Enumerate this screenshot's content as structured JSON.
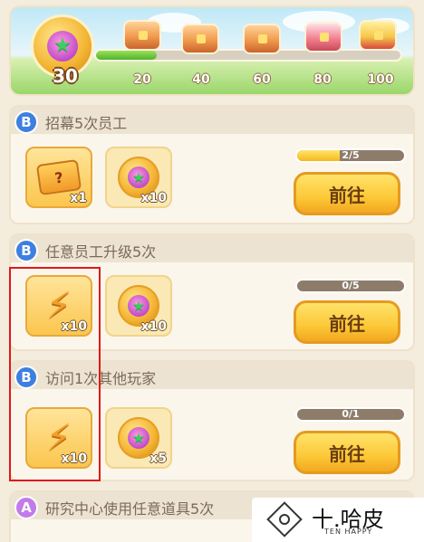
{
  "top_progress": {
    "current_level": "30",
    "fill_fraction": 0.2,
    "milestones": [
      "20",
      "40",
      "60",
      "80",
      "100"
    ]
  },
  "tasks": [
    {
      "grade": "B",
      "title": "招幕5次员工",
      "rewards": [
        {
          "icon": "ticket-icon",
          "qty": "x1"
        },
        {
          "icon": "star-coin-icon",
          "qty": "x10"
        }
      ],
      "progress_text": "2/5",
      "progress_fraction": 0.4,
      "button_label": "前往"
    },
    {
      "grade": "B",
      "title": "任意员工升级5次",
      "rewards": [
        {
          "icon": "lightning-icon",
          "qty": "x10"
        },
        {
          "icon": "star-coin-icon",
          "qty": "x10"
        }
      ],
      "progress_text": "0/5",
      "progress_fraction": 0,
      "button_label": "前往"
    },
    {
      "grade": "B",
      "title": "访问1次其他玩家",
      "rewards": [
        {
          "icon": "lightning-icon",
          "qty": "x10"
        },
        {
          "icon": "star-coin-icon",
          "qty": "x5"
        }
      ],
      "progress_text": "0/1",
      "progress_fraction": 0,
      "button_label": "前往"
    },
    {
      "grade": "A",
      "title": "研究中心使用任意道具5次"
    }
  ],
  "watermark": {
    "name": "十.哈皮",
    "sub": "TEN HAPPY"
  },
  "colors": {
    "highlight": "#e01818",
    "button": "#fcc838",
    "grade_b": "#3e7fe0",
    "grade_a": "#c27be8"
  }
}
